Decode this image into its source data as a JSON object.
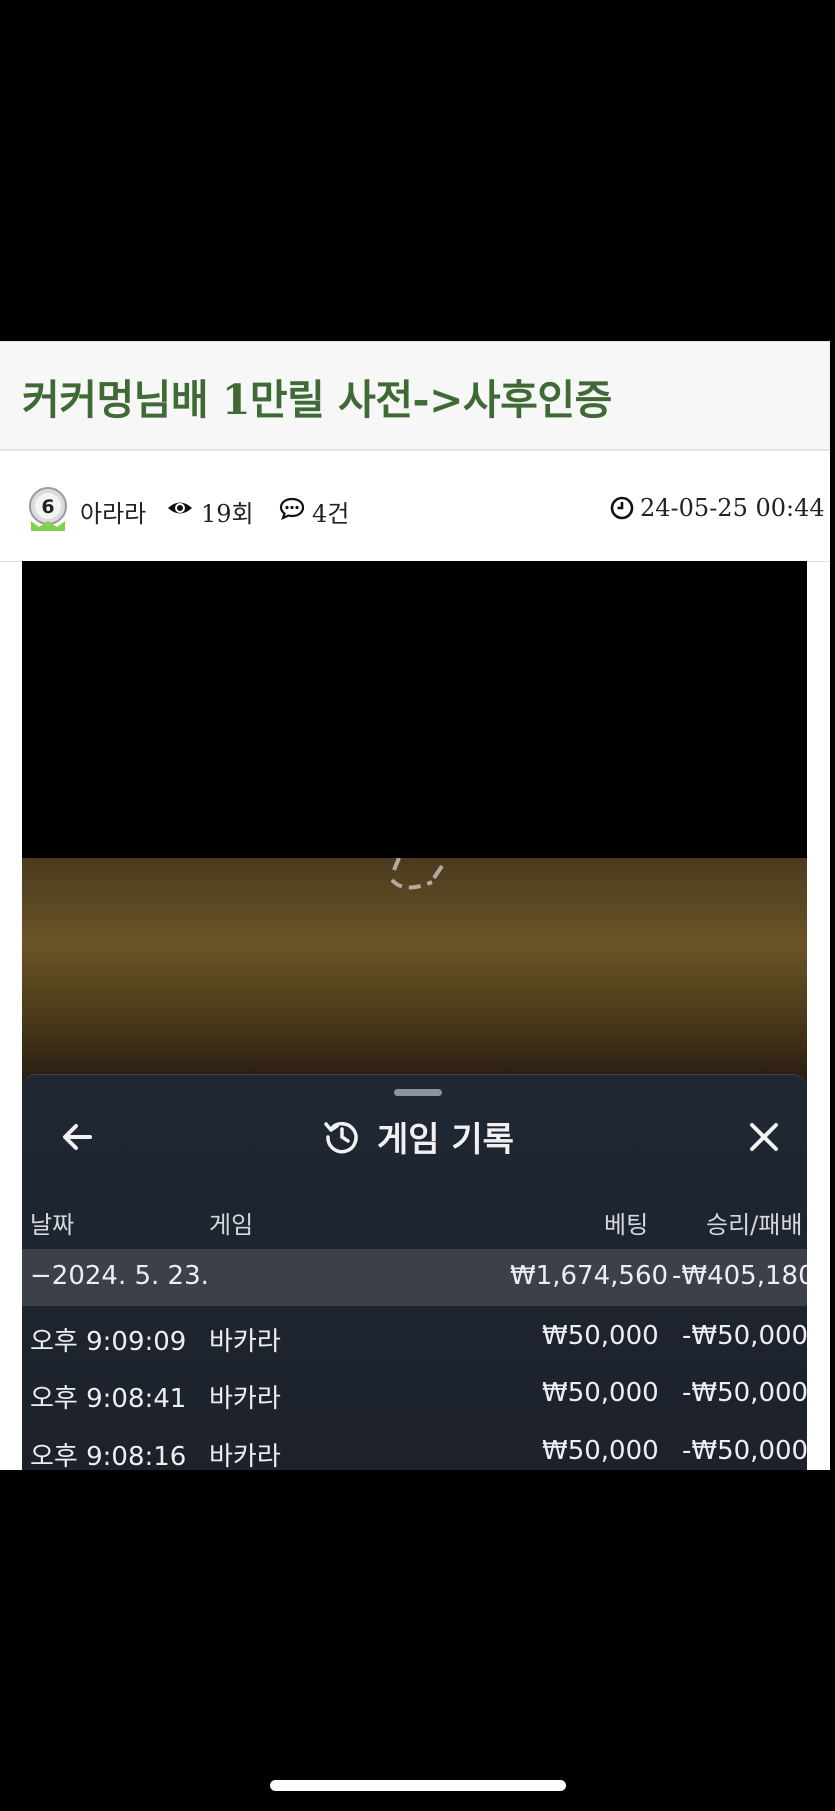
{
  "post": {
    "title": "커커멍님배 1만릴 사전->사후인증",
    "author": "아라라",
    "views": "19회",
    "comments": "4건",
    "datetime": "24-05-25 00:44",
    "level_badge": "6"
  },
  "history_panel": {
    "title": "게임 기록",
    "columns": {
      "date": "날짜",
      "game": "게임",
      "bet": "베팅",
      "result": "승리/패배"
    },
    "date_group": {
      "label": "−2024. 5. 23.",
      "bet_total": "₩1,674,560",
      "result_total": "-₩405,180"
    },
    "rows": [
      {
        "time": "오후 9:09:09",
        "game": "바카라",
        "bet": "₩50,000",
        "result": "-₩50,000"
      },
      {
        "time": "오후 9:08:41",
        "game": "바카라",
        "bet": "₩50,000",
        "result": "-₩50,000"
      },
      {
        "time": "오후 9:08:16",
        "game": "바카라",
        "bet": "₩50,000",
        "result": "-₩50,000"
      }
    ]
  },
  "colors": {
    "title_green": "#3f6a35",
    "panel_bg": "#1f2833",
    "date_row_bg": "#3b4049"
  }
}
